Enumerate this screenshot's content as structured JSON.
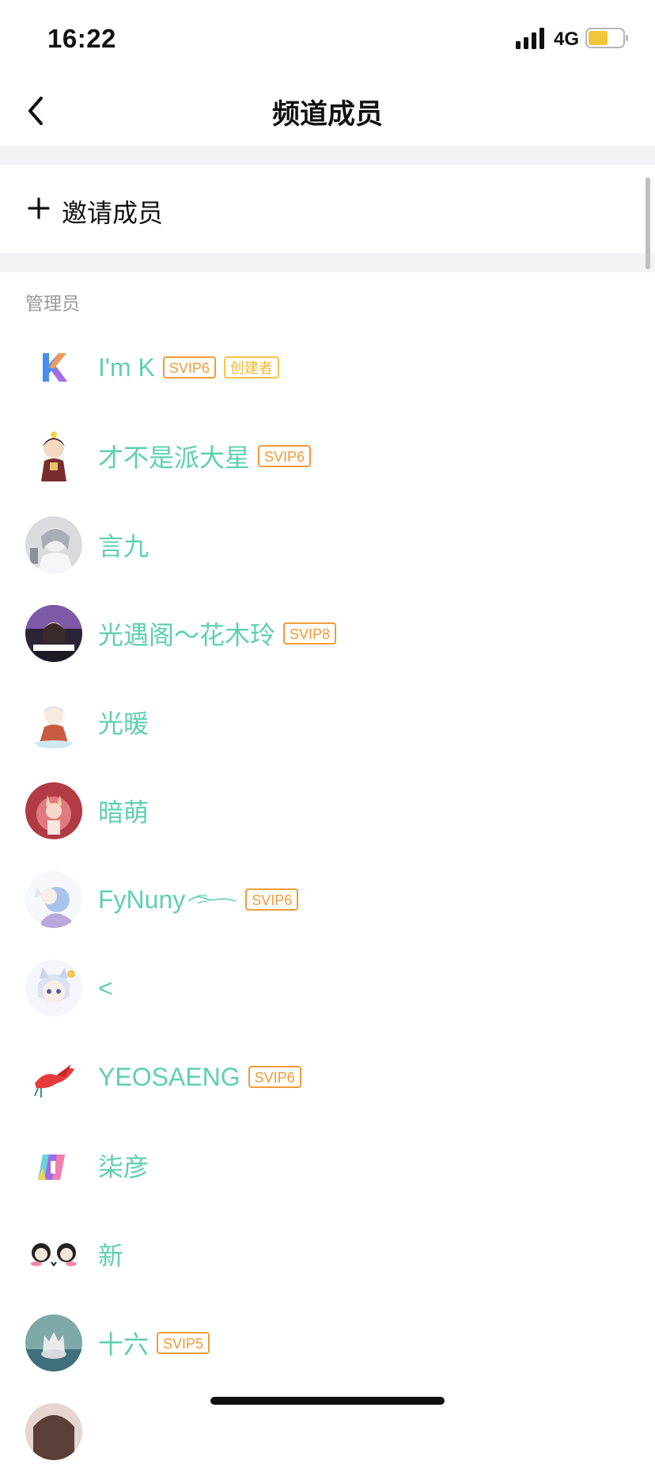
{
  "status_bar": {
    "time": "16:22",
    "network": "4G",
    "icons": [
      "signal-icon",
      "battery-icon"
    ]
  },
  "nav": {
    "title": "频道成员",
    "back_icon": "chevron-left-icon"
  },
  "invite": {
    "icon": "plus-icon",
    "label": "邀请成员"
  },
  "section": {
    "admin_header": "管理员"
  },
  "members": [
    {
      "name": "I'm K",
      "badges": [
        "SVIP6",
        "创建者"
      ]
    },
    {
      "name": "才不是派大星",
      "badges": [
        "SVIP6"
      ]
    },
    {
      "name": "言九",
      "badges": []
    },
    {
      "name": "光遇阁～花木玲",
      "badges": [
        "SVIP8"
      ]
    },
    {
      "name": "光暖",
      "badges": []
    },
    {
      "name": "暗萌",
      "badges": []
    },
    {
      "name": "FyNuny",
      "badges": [
        "SVIP6"
      ]
    },
    {
      "name": "<",
      "badges": []
    },
    {
      "name": "YEOSAENG",
      "badges": [
        "SVIP6"
      ]
    },
    {
      "name": "柒彦",
      "badges": []
    },
    {
      "name": "新",
      "badges": []
    },
    {
      "name": "十六",
      "badges": [
        "SVIP5"
      ]
    }
  ],
  "colors": {
    "name_text": "#5fcfb1",
    "svip_badge": "#f29b3a",
    "creator_badge": "#f3b935",
    "section_gap": "#f3f3f6",
    "section_header_text": "#9a9a9a"
  }
}
